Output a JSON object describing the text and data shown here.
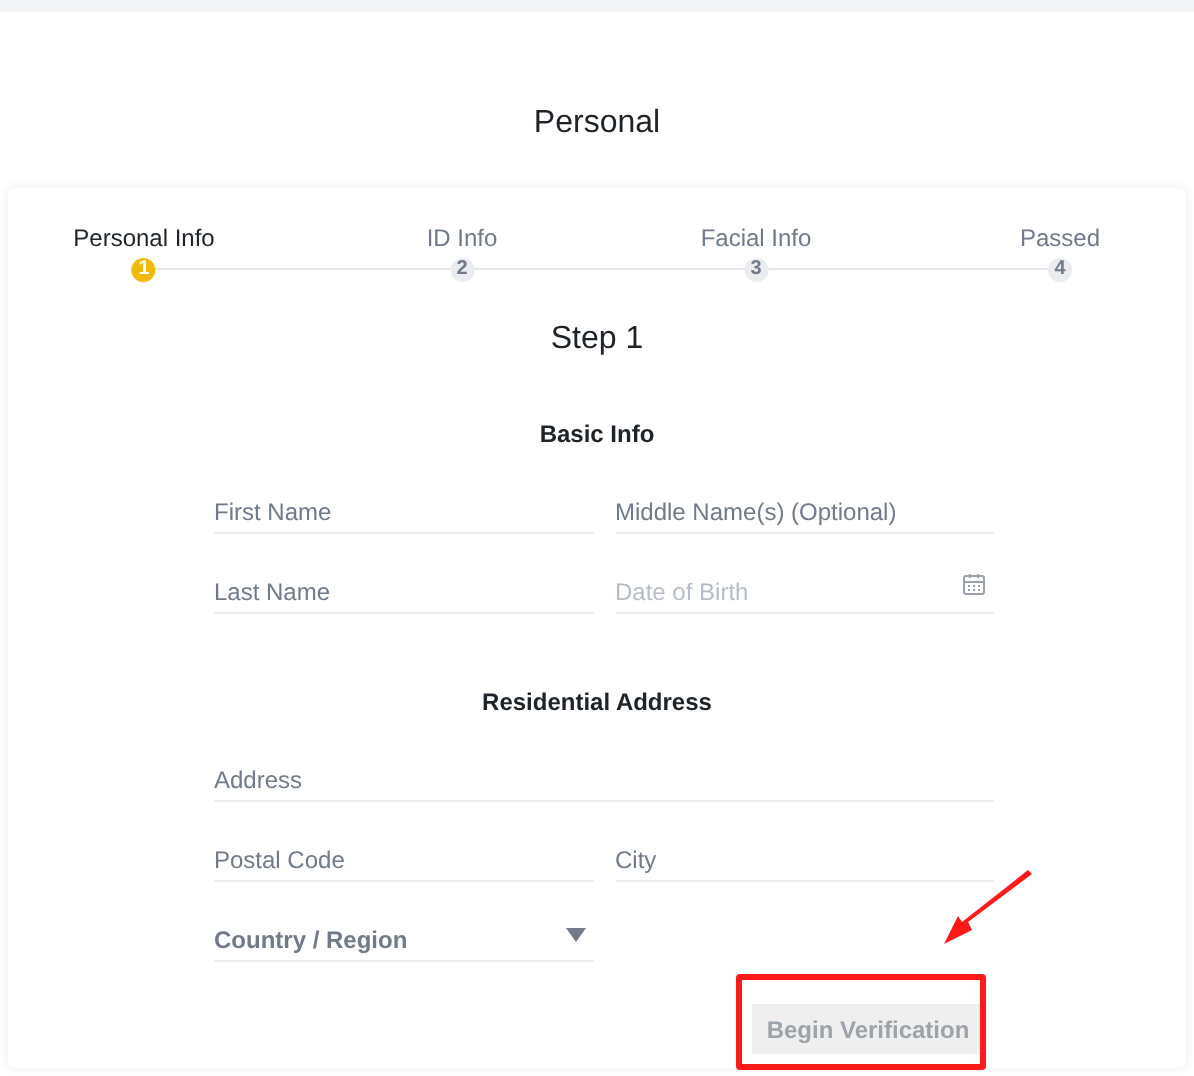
{
  "page_title": "Personal",
  "steps": [
    {
      "label": "Personal Info",
      "number": "1",
      "selected": true
    },
    {
      "label": "ID Info",
      "number": "2",
      "selected": false
    },
    {
      "label": "Facial Info",
      "number": "3",
      "selected": false
    },
    {
      "label": "Passed",
      "number": "4",
      "selected": false
    }
  ],
  "step_title": "Step 1",
  "sections": [
    {
      "title": "Basic Info",
      "rows": [
        [
          {
            "kind": "text",
            "placeholder": "First Name"
          },
          {
            "kind": "text",
            "placeholder": "Middle Name(s) (Optional)"
          }
        ],
        [
          {
            "kind": "text",
            "placeholder": "Last Name"
          },
          {
            "kind": "date",
            "placeholder": "Date of Birth"
          }
        ]
      ]
    },
    {
      "title": "Residential Address",
      "rows": [
        [
          {
            "kind": "text",
            "placeholder": "Address"
          }
        ],
        [
          {
            "kind": "text",
            "placeholder": "Postal Code"
          },
          {
            "kind": "text",
            "placeholder": "City"
          }
        ],
        [
          {
            "kind": "select",
            "placeholder": "Country / Region"
          }
        ]
      ]
    }
  ],
  "submit": {
    "label": "Begin Verification",
    "disabled": true
  }
}
